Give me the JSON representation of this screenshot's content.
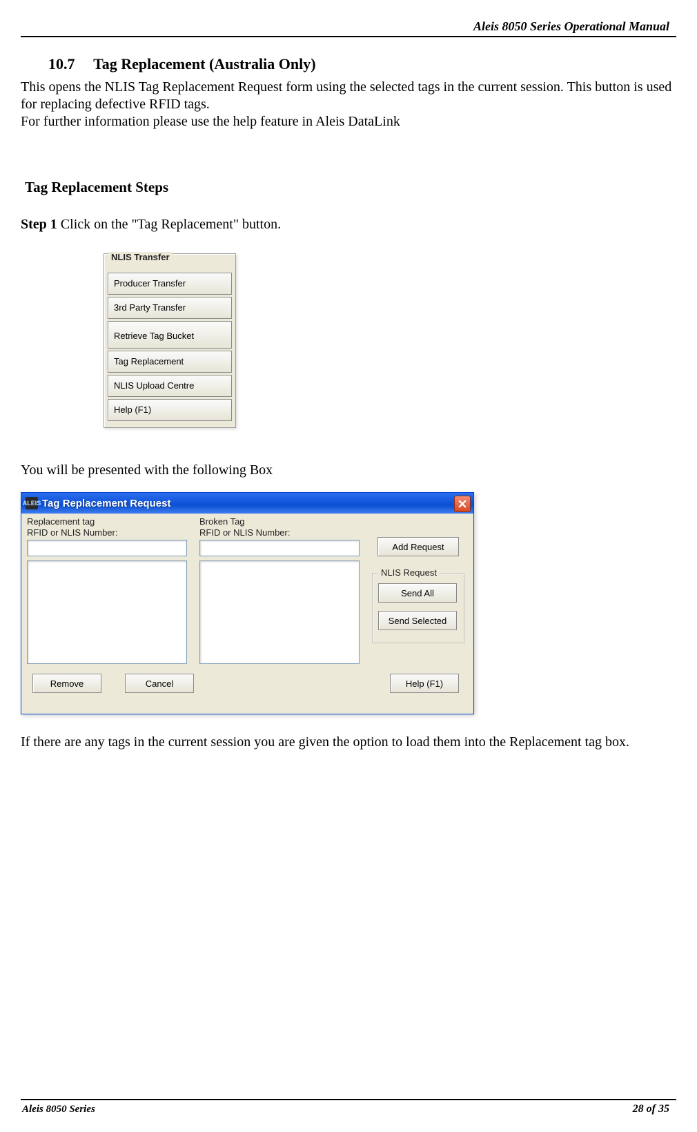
{
  "header": {
    "doc_title": "Aleis 8050 Series Operational Manual"
  },
  "section": {
    "number": "10.7",
    "title": "Tag Replacement (Australia Only)",
    "intro_line1": "This opens the NLIS Tag Replacement Request form using the selected tags in the current session. This button is used for replacing defective RFID tags.",
    "intro_line2": "For further information please use the help feature in Aleis DataLink"
  },
  "steps_heading": "Tag Replacement Steps",
  "step1": {
    "label": "Step 1",
    "text": " Click on the \"Tag Replacement\"  button."
  },
  "nlis_menu": {
    "legend": "NLIS Transfer",
    "items": [
      "Producer Transfer",
      "3rd Party Transfer",
      "Retrieve Tag Bucket",
      "Tag Replacement",
      "NLIS Upload Centre",
      "Help (F1)"
    ]
  },
  "present_line": "You will be presented with the following Box",
  "dialog": {
    "app_icon_text": "ALEIS",
    "title": "Tag Replacement Request",
    "col1_line1": "Replacement tag",
    "col1_line2": "RFID or NLIS Number:",
    "col2_line1": "Broken Tag",
    "col2_line2": "RFID or NLIS Number:",
    "add_request": "Add Request",
    "group_label": "NLIS Request",
    "send_all": "Send All",
    "send_selected": "Send Selected",
    "remove": "Remove",
    "cancel": "Cancel",
    "help": "Help (F1)"
  },
  "follow_text": " If there are any tags in the current session you are given the option to load them into the Replacement tag box.",
  "footer": {
    "left": "Aleis 8050 Series",
    "right": "28 of 35"
  }
}
